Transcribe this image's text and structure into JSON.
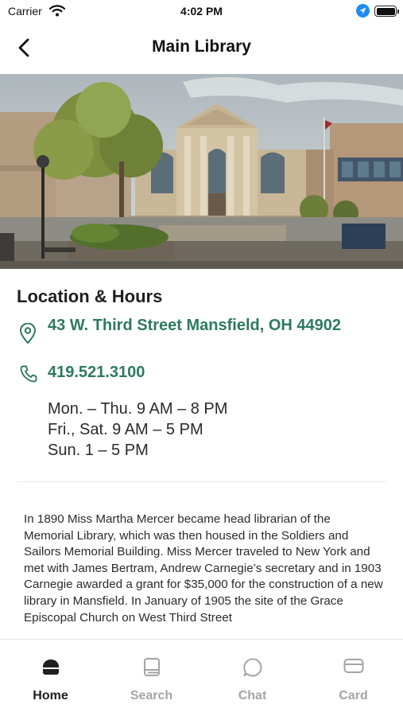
{
  "status_bar": {
    "carrier": "Carrier",
    "time": "4:02 PM"
  },
  "nav": {
    "title": "Main Library"
  },
  "location": {
    "section_title": "Location & Hours",
    "address": "43 W. Third Street Mansfield, OH 44902",
    "phone": "419.521.3100",
    "hours": [
      "Mon. – Thu. 9 AM – 8 PM",
      "Fri., Sat. 9 AM – 5 PM",
      "Sun. 1 – 5 PM"
    ]
  },
  "description": "In 1890 Miss Martha Mercer became head librarian of the Memorial Library, which was then housed in the Soldiers and Sailors Memorial Building. Miss Mercer traveled to New York and met with James Bertram, Andrew Carnegie’s secretary and in 1903 Carnegie awarded a grant for $35,000 for the construction of a new library in Mansfield. In January of 1905 the site of the Grace Episcopal Church on West Third Street",
  "tabs": [
    {
      "label": "Home",
      "icon": "home-icon",
      "active": true
    },
    {
      "label": "Search",
      "icon": "book-icon",
      "active": false
    },
    {
      "label": "Chat",
      "icon": "chat-bubble-icon",
      "active": false
    },
    {
      "label": "Card",
      "icon": "card-icon",
      "active": false
    }
  ],
  "colors": {
    "accent": "#2d7a60",
    "active_tab": "#1f1f1f",
    "inactive_tab": "#a4a4a4",
    "location_indicator": "#1e8bf5"
  }
}
